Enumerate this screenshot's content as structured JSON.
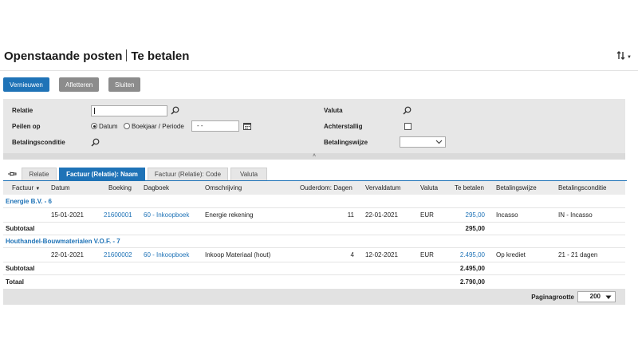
{
  "header": {
    "title_main": "Openstaande posten",
    "title_sub": "Te betalen"
  },
  "toolbar": {
    "refresh_label": "Vernieuwen",
    "settle_label": "Afletteren",
    "close_label": "Sluiten"
  },
  "filters": {
    "relatie_label": "Relatie",
    "relatie_value": "",
    "peilen_label": "Peilen op",
    "peilen_option_datum": "Datum",
    "peilen_option_boekjaar": "Boekjaar / Periode",
    "peilen_selected": "Datum",
    "date_value": "- -",
    "betalingsconditie_label": "Betalingsconditie",
    "valuta_label": "Valuta",
    "achterstallig_label": "Achterstallig",
    "achterstallig_checked": false,
    "betalingswijze_label": "Betalingswijze",
    "betalingswijze_value": ""
  },
  "tabs": [
    {
      "label": "Relatie",
      "active": false
    },
    {
      "label": "Factuur (Relatie): Naam",
      "active": true
    },
    {
      "label": "Factuur (Relatie): Code",
      "active": false
    },
    {
      "label": "Valuta",
      "active": false
    }
  ],
  "table": {
    "columns": [
      "Factuur",
      "Datum",
      "Boeking",
      "Dagboek",
      "Omschrijving",
      "Ouderdom: Dagen",
      "Vervaldatum",
      "Valuta",
      "Te betalen",
      "Betalingswijze",
      "Betalingsconditie"
    ],
    "groups": [
      {
        "name": "Energie B.V. - 6",
        "rows": [
          {
            "factuur": "",
            "datum": "15-01-2021",
            "boeking": "21600001",
            "dagboek": "60 - Inkoopboek",
            "omschrijving": "Energie rekening",
            "ouderdom": "11",
            "vervaldatum": "22-01-2021",
            "valuta": "EUR",
            "te_betalen": "295,00",
            "betalingswijze": "Incasso",
            "betalingsconditie": "IN - Incasso"
          }
        ],
        "subtotal_label": "Subtotaal",
        "subtotal": "295,00"
      },
      {
        "name": "Houthandel-Bouwmaterialen V.O.F. - 7",
        "rows": [
          {
            "factuur": "",
            "datum": "22-01-2021",
            "boeking": "21600002",
            "dagboek": "60 - Inkoopboek",
            "omschrijving": "Inkoop Materiaal (hout)",
            "ouderdom": "4",
            "vervaldatum": "12-02-2021",
            "valuta": "EUR",
            "te_betalen": "2.495,00",
            "betalingswijze": "Op krediet",
            "betalingsconditie": "21 - 21 dagen"
          }
        ],
        "subtotal_label": "Subtotaal",
        "subtotal": "2.495,00"
      }
    ],
    "total_label": "Totaal",
    "total": "2.790,00"
  },
  "footer": {
    "pagesize_label": "Paginagrootte",
    "pagesize_value": "200"
  },
  "colors": {
    "accent": "#1f73b7",
    "button_grey": "#8c8c8c",
    "panel_bg": "#e7e7e7"
  }
}
